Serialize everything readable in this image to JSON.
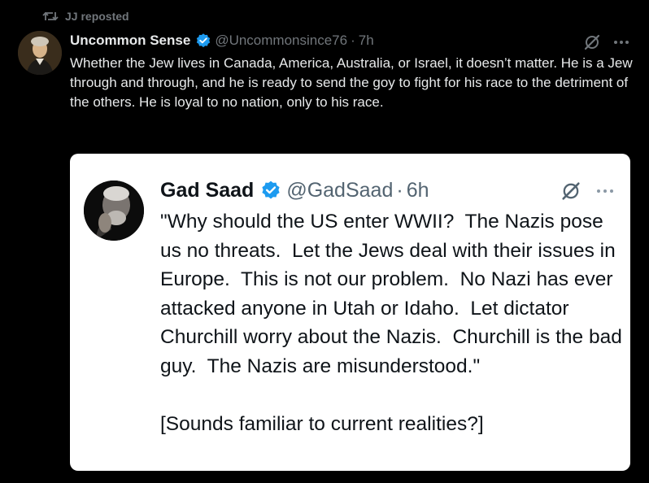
{
  "repost": {
    "label": "JJ reposted",
    "icon": "repost-icon"
  },
  "tweet": {
    "author_name": "Uncommon Sense",
    "handle": "@Uncommonsince76",
    "separator": "·",
    "time": "7h",
    "text": "Whether the Jew lives in Canada, America, Australia, or Israel, it doesn’t matter. He is a Jew through and through, and he is ready to send the goy to fight for his race to the detriment of the others. He is loyal to no nation, only to his race."
  },
  "quote": {
    "author_name": "Gad Saad",
    "handle": "@GadSaad",
    "separator": "·",
    "time": "6h",
    "text": "\"Why should the US enter WWII?  The Nazis pose us no threats.  Let the Jews deal with their issues in Europe.  This is not our problem.  No Nazi has ever attacked anyone in Utah or Idaho.  Let dictator Churchill worry about the Nazis.  Churchill is the bad guy.  The Nazis are misunderstood.\"\n\n[Sounds familiar to current realities?]"
  },
  "colors": {
    "background": "#000000",
    "text_primary": "#e7e9ea",
    "text_secondary": "#71767b",
    "verified_blue": "#1d9bf0",
    "card_background": "#ffffff",
    "card_text": "#0f1419",
    "card_secondary": "#536471"
  }
}
